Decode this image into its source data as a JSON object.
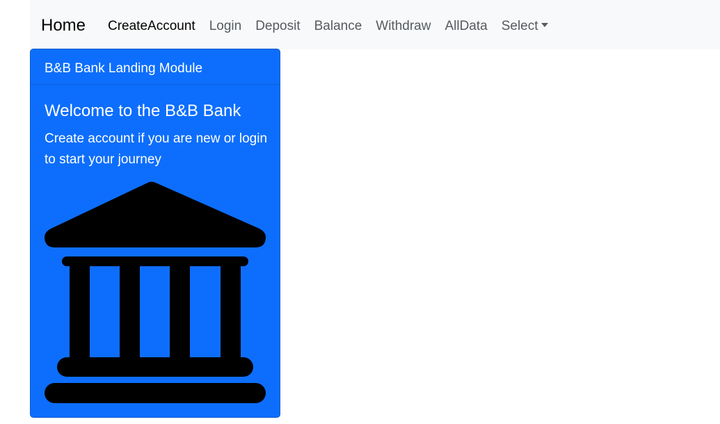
{
  "navbar": {
    "brand": "Home",
    "links": [
      {
        "label": "CreateAccount"
      },
      {
        "label": "Login"
      },
      {
        "label": "Deposit"
      },
      {
        "label": "Balance"
      },
      {
        "label": "Withdraw"
      },
      {
        "label": "AllData"
      },
      {
        "label": "Select"
      }
    ]
  },
  "card": {
    "header": "B&B Bank Landing Module",
    "title": "Welcome to the B&B Bank",
    "text": "Create account if you are new or login to start your journey",
    "icon": "bank-icon"
  },
  "colors": {
    "card_bg": "#0d6efd",
    "navbar_bg": "#f8f9fa",
    "icon": "#000000"
  }
}
